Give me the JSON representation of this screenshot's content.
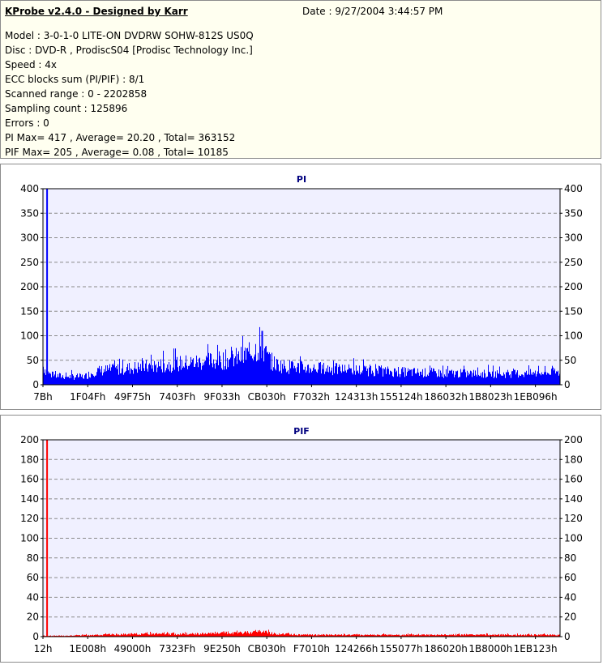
{
  "header": {
    "title": "KProbe v2.4.0 - Designed by Karr",
    "date": "Date : 9/27/2004 3:44:57 PM",
    "lines": [
      "Model : 3-0-1-0 LITE-ON DVDRW SOHW-812S  US0Q",
      "Disc : DVD-R , ProdiscS04   [Prodisc Technology Inc.]",
      "Speed : 4x",
      "ECC blocks sum (PI/PIF) : 8/1",
      "Scanned range : 0 - 2202858",
      "Sampling count : 125896",
      "Errors : 0",
      "PI Max= 417 , Average= 20.20 , Total= 363152",
      "PIF Max= 205 , Average= 0.08 , Total= 10185"
    ]
  },
  "colors": {
    "pi": "#0000ff",
    "pif": "#ff0000",
    "plot_bg": "#f0f0ff",
    "title": "#00007f"
  },
  "chart_data": [
    {
      "type": "area",
      "title": "PI",
      "ylim": [
        0,
        400
      ],
      "yticks": [
        0,
        50,
        100,
        150,
        200,
        250,
        300,
        350,
        400
      ],
      "xticks": [
        "7Bh",
        "1F04Fh",
        "49F75h",
        "7403Fh",
        "9F033h",
        "CB030h",
        "F7032h",
        "124313h",
        "155124h",
        "186032h",
        "1B8023h",
        "1EB096h"
      ],
      "grid": true,
      "x_fraction": [
        0,
        0.01,
        0.02,
        0.05,
        0.08,
        0.1,
        0.15,
        0.2,
        0.25,
        0.3,
        0.35,
        0.38,
        0.4,
        0.42,
        0.44,
        0.45,
        0.47,
        0.5,
        0.55,
        0.6,
        0.65,
        0.7,
        0.75,
        0.8,
        0.85,
        0.9,
        0.95,
        1.0
      ],
      "envelope": [
        40,
        25,
        20,
        18,
        18,
        30,
        35,
        40,
        45,
        50,
        55,
        60,
        70,
        85,
        50,
        45,
        40,
        38,
        35,
        33,
        30,
        28,
        26,
        25,
        24,
        24,
        25,
        28
      ],
      "spikes": [
        {
          "x_fraction": 0.008,
          "value": 417
        },
        {
          "x_fraction": 0.424,
          "value": 110
        }
      ]
    },
    {
      "type": "area",
      "title": "PIF",
      "ylim": [
        0,
        200
      ],
      "yticks": [
        0,
        20,
        40,
        60,
        80,
        100,
        120,
        140,
        160,
        180,
        200
      ],
      "xticks": [
        "12h",
        "1E008h",
        "49000h",
        "7323Fh",
        "9E250h",
        "CB030h",
        "F7010h",
        "124266h",
        "155077h",
        "186020h",
        "1B8000h",
        "1EB123h"
      ],
      "grid": true,
      "x_fraction": [
        0,
        0.05,
        0.1,
        0.2,
        0.3,
        0.38,
        0.42,
        0.45,
        0.5,
        0.6,
        0.7,
        0.8,
        0.9,
        1.0
      ],
      "envelope": [
        1,
        1,
        2,
        3,
        3,
        4,
        6,
        3,
        2,
        2,
        2,
        2,
        2,
        2
      ],
      "spikes": [
        {
          "x_fraction": 0.008,
          "value": 205
        }
      ]
    }
  ]
}
